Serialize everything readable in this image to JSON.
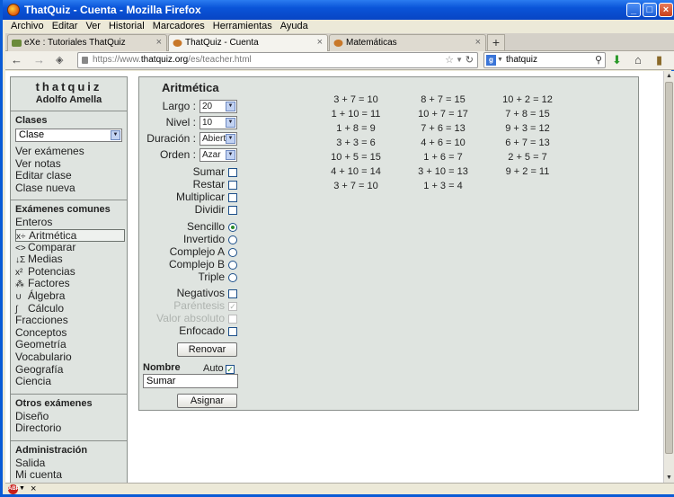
{
  "window": {
    "title": "ThatQuiz - Cuenta - Mozilla Firefox"
  },
  "menu": [
    "Archivo",
    "Editar",
    "Ver",
    "Historial",
    "Marcadores",
    "Herramientas",
    "Ayuda"
  ],
  "tabs": [
    {
      "label": "eXe : Tutoriales ThatQuiz"
    },
    {
      "label": "ThatQuiz - Cuenta"
    },
    {
      "label": "Matemáticas"
    }
  ],
  "newtab": "+",
  "url": {
    "prefix": "https://www.",
    "domain": "thatquiz.org",
    "path": "/es/teacher.html"
  },
  "search": {
    "value": "thatquiz",
    "engine": "g-icon"
  },
  "sidebar": {
    "brand": "thatquiz",
    "user": "Adolfo Amella",
    "clases": {
      "heading": "Clases",
      "select": "Clase",
      "links": [
        "Ver exámenes",
        "Ver notas",
        "Editar clase",
        "Clase nueva"
      ]
    },
    "comunes": {
      "heading": "Exámenes comunes",
      "items": [
        {
          "glyph": "",
          "label": "Enteros"
        },
        {
          "glyph": "x÷",
          "label": "Aritmética"
        },
        {
          "glyph": "<>",
          "label": "Comparar"
        },
        {
          "glyph": "↓Σ",
          "label": "Medias"
        },
        {
          "glyph": "x²",
          "label": "Potencias"
        },
        {
          "glyph": "⁂",
          "label": "Factores"
        },
        {
          "glyph": "∪",
          "label": "Álgebra"
        },
        {
          "glyph": "∫",
          "label": "Cálculo"
        },
        {
          "glyph": "",
          "label": "Fracciones"
        },
        {
          "glyph": "",
          "label": "Conceptos"
        },
        {
          "glyph": "",
          "label": "Geometría"
        },
        {
          "glyph": "",
          "label": "Vocabulario"
        },
        {
          "glyph": "",
          "label": "Geografía"
        },
        {
          "glyph": "",
          "label": "Ciencia"
        }
      ]
    },
    "otros": {
      "heading": "Otros exámenes",
      "links": [
        "Diseño",
        "Directorio"
      ]
    },
    "admin": {
      "heading": "Administración",
      "links": [
        "Salida",
        "Mi cuenta"
      ]
    }
  },
  "panel": {
    "title": "Aritmética",
    "largo": {
      "label": "Largo :",
      "value": "20"
    },
    "nivel": {
      "label": "Nivel :",
      "value": "10"
    },
    "duracion": {
      "label": "Duración :",
      "value": "Abierto"
    },
    "orden": {
      "label": "Orden :",
      "value": "Azar"
    },
    "ops": [
      {
        "label": "Sumar",
        "checked": false
      },
      {
        "label": "Restar",
        "checked": false
      },
      {
        "label": "Multiplicar",
        "checked": false
      },
      {
        "label": "Dividir",
        "checked": false
      }
    ],
    "tipos": [
      {
        "label": "Sencillo",
        "selected": true
      },
      {
        "label": "Invertido",
        "selected": false
      },
      {
        "label": "Complejo A",
        "selected": false
      },
      {
        "label": "Complejo B",
        "selected": false
      },
      {
        "label": "Triple",
        "selected": false
      }
    ],
    "opts": [
      {
        "label": "Negativos",
        "checked": false,
        "disabled": false
      },
      {
        "label": "Paréntesis",
        "checked": true,
        "disabled": true
      },
      {
        "label": "Valor absoluto",
        "checked": false,
        "disabled": true
      },
      {
        "label": "Enfocado",
        "checked": false,
        "disabled": false
      }
    ],
    "renovar": "Renovar",
    "nombre_label": "Nombre",
    "auto_label": "Auto",
    "auto_checked": true,
    "nombre_value": "Sumar",
    "asignar": "Asignar",
    "problems": [
      [
        "3 + 7 = 10",
        "1 + 10 = 11",
        "1 + 8 = 9",
        "3 + 3 = 6",
        "10 + 5 = 15",
        "4 + 10 = 14",
        "3 + 7 = 10"
      ],
      [
        "8 + 7 = 15",
        "10 + 7 = 17",
        "7 + 6 = 13",
        "4 + 6 = 10",
        "1 + 6 = 7",
        "3 + 10 = 13",
        "1 + 3 = 4"
      ],
      [
        "10 + 2 = 12",
        "7 + 8 = 15",
        "9 + 3 = 12",
        "6 + 7 = 13",
        "2 + 5 = 7",
        "9 + 2 = 11"
      ]
    ]
  }
}
